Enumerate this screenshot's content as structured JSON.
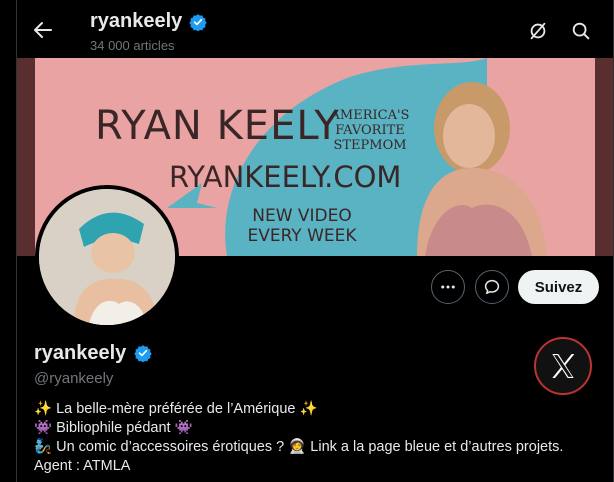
{
  "header": {
    "username": "ryankeely",
    "article_count": "34 000 articles",
    "verified": true
  },
  "banner": {
    "title": "RYAN KEELY",
    "tagline": "AMERICA'S FAVORITE STEPMOM",
    "url": "RYANKEELY.COM",
    "promo": "NEW VIDEO EVERY WEEK",
    "colors": {
      "pink": "#e9a3a3",
      "teal": "#5ab3c3",
      "dark_red": "#5a2e2e"
    }
  },
  "actions": {
    "more_icon": "more-dots-icon",
    "message_icon": "message-bubble-icon",
    "follow_label": "Suivez"
  },
  "profile": {
    "display_name": "ryankeely",
    "handle": "@ryankeely",
    "bio": [
      {
        "prefix": "✨",
        "text": " La belle-mère préférée de l’Amérique ",
        "suffix": "✨"
      },
      {
        "prefix": "👾",
        "text": " Bibliophile pédant ",
        "suffix": "👾"
      },
      {
        "prefix": "🧞",
        "text": " Un comic d’accessoires érotiques ? ",
        "suffix": "🧑‍🚀",
        "tail": " Link a la page bleue et d’autres projets."
      },
      {
        "prefix": "",
        "text": "Agent : ATMLA",
        "suffix": ""
      }
    ]
  },
  "colors": {
    "background": "#000000",
    "text": "#e7e9ea",
    "muted": "#71767b",
    "verified_blue": "#1d9bf0",
    "follow_bg": "#eff3f4"
  }
}
